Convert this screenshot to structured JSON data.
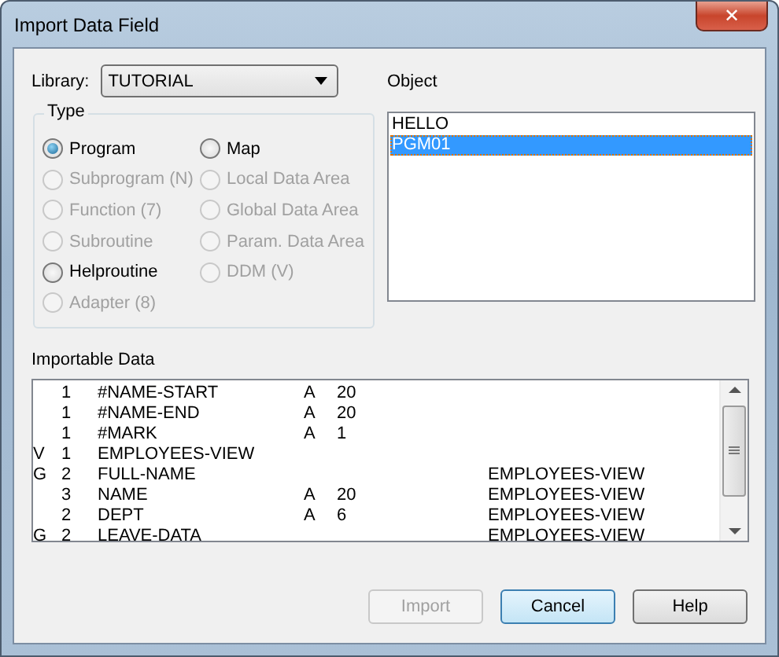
{
  "window": {
    "title": "Import Data Field",
    "close_glyph": "✕"
  },
  "library": {
    "label": "Library:",
    "value": "TUTORIAL"
  },
  "type_group": {
    "title": "Type",
    "options": [
      {
        "label": "Program",
        "selected": true,
        "disabled": false
      },
      {
        "label": "Map",
        "selected": false,
        "disabled": false
      },
      {
        "label": "Subprogram (N)",
        "selected": false,
        "disabled": true
      },
      {
        "label": "Local Data Area",
        "selected": false,
        "disabled": true
      },
      {
        "label": "Function (7)",
        "selected": false,
        "disabled": true
      },
      {
        "label": "Global Data Area",
        "selected": false,
        "disabled": true
      },
      {
        "label": "Subroutine",
        "selected": false,
        "disabled": true
      },
      {
        "label": "Param. Data Area",
        "selected": false,
        "disabled": true
      },
      {
        "label": "Helproutine",
        "selected": false,
        "disabled": false
      },
      {
        "label": "DDM (V)",
        "selected": false,
        "disabled": true
      },
      {
        "label": "Adapter (8)",
        "selected": false,
        "disabled": true
      }
    ]
  },
  "object": {
    "label": "Object",
    "items": [
      {
        "label": "HELLO",
        "selected": false
      },
      {
        "label": "PGM01",
        "selected": true
      }
    ]
  },
  "importable_data": {
    "label": "Importable Data",
    "rows": [
      {
        "level": "1",
        "name": "#NAME-START",
        "format": "A",
        "length": "20"
      },
      {
        "level": "1",
        "name": "#NAME-END",
        "format": "A",
        "length": "20"
      },
      {
        "level": "1",
        "name": "#MARK",
        "format": "A",
        "length": "1"
      },
      {
        "flag": "V",
        "level": "1",
        "name": "EMPLOYEES-VIEW"
      },
      {
        "flag": "G",
        "level": "2",
        "name": "FULL-NAME",
        "view": "EMPLOYEES-VIEW"
      },
      {
        "level": "3",
        "name": "NAME",
        "format": "A",
        "length": "20",
        "view": "EMPLOYEES-VIEW"
      },
      {
        "level": "2",
        "name": "DEPT",
        "format": "A",
        "length": "6",
        "view": "EMPLOYEES-VIEW"
      },
      {
        "flag": "G",
        "level": "2",
        "name": "LEAVE-DATA",
        "view": "EMPLOYEES-VIEW"
      }
    ]
  },
  "buttons": [
    {
      "label": "Import",
      "disabled": true,
      "default": false
    },
    {
      "label": "Cancel",
      "disabled": false,
      "default": true
    },
    {
      "label": "Help",
      "disabled": false,
      "default": false
    }
  ]
}
